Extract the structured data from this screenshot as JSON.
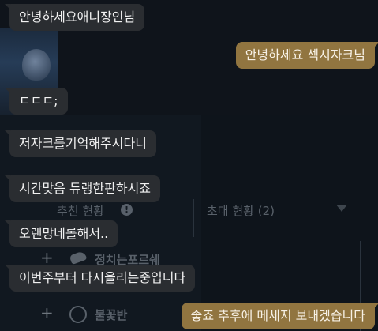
{
  "background": {
    "recommend_label": "추천 현황",
    "invite_label": "초대 현황 (2)",
    "item_one": "정치는포르쉐",
    "item_two": "불꽃반",
    "plus_glyph": "+"
  },
  "messages": [
    {
      "direction": "received",
      "text": "안녕하세요애니장인님"
    },
    {
      "direction": "sent",
      "text": "안녕하세요 섹시자크님"
    },
    {
      "direction": "received",
      "text": "ㄷㄷㄷ;"
    },
    {
      "direction": "received",
      "text": "저자크를기억해주시다니"
    },
    {
      "direction": "received",
      "text": "시간맞음 듀랭한판하시죠"
    },
    {
      "direction": "received",
      "text": "오랜망네롤해서.."
    },
    {
      "direction": "received",
      "text": "이번주부터 다시올리는중입니다"
    },
    {
      "direction": "sent",
      "text": "좋죠 추후에 메세지 보내겠습니다"
    }
  ],
  "colors": {
    "received_bubble": "#2a2d31",
    "sent_bubble": "#917540",
    "background": "#0f141b"
  }
}
